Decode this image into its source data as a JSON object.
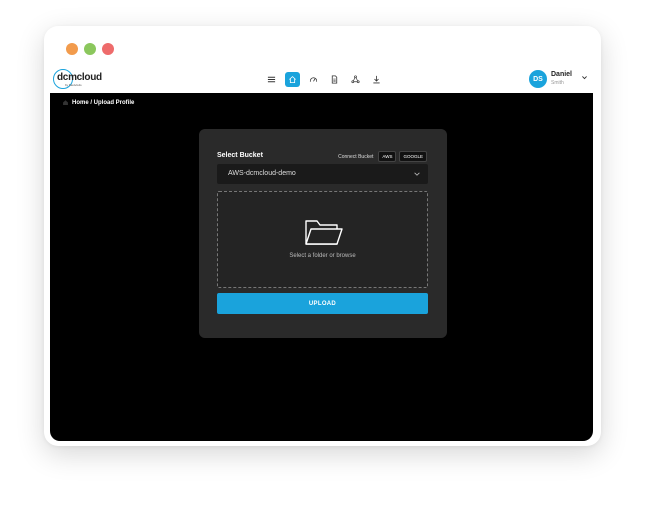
{
  "logo": {
    "text": "dcmcloud",
    "subtext": "by Medvis4s"
  },
  "nav": [
    {
      "name": "menu",
      "icon": "menu-icon"
    },
    {
      "name": "home",
      "icon": "home-icon",
      "active": true
    },
    {
      "name": "dashboard",
      "icon": "dashboard-icon"
    },
    {
      "name": "document",
      "icon": "document-icon"
    },
    {
      "name": "share",
      "icon": "share-icon"
    },
    {
      "name": "download",
      "icon": "download-icon"
    }
  ],
  "user": {
    "initials": "DS",
    "first_name": "Daniel",
    "last_name": "Smith"
  },
  "breadcrumb": {
    "text": "Home / Upload Profile"
  },
  "card": {
    "title": "Select Bucket",
    "connect_label": "Connect Bucket",
    "providers": [
      "AWS",
      "GOOGLE"
    ],
    "bucket_value": "AWS-dcmcloud-demo",
    "dropzone_text": "Select a folder or browse",
    "upload_label": "UPLOAD"
  },
  "colors": {
    "accent": "#1aa3dc",
    "background": "#000000",
    "card": "#2a2a2a"
  }
}
